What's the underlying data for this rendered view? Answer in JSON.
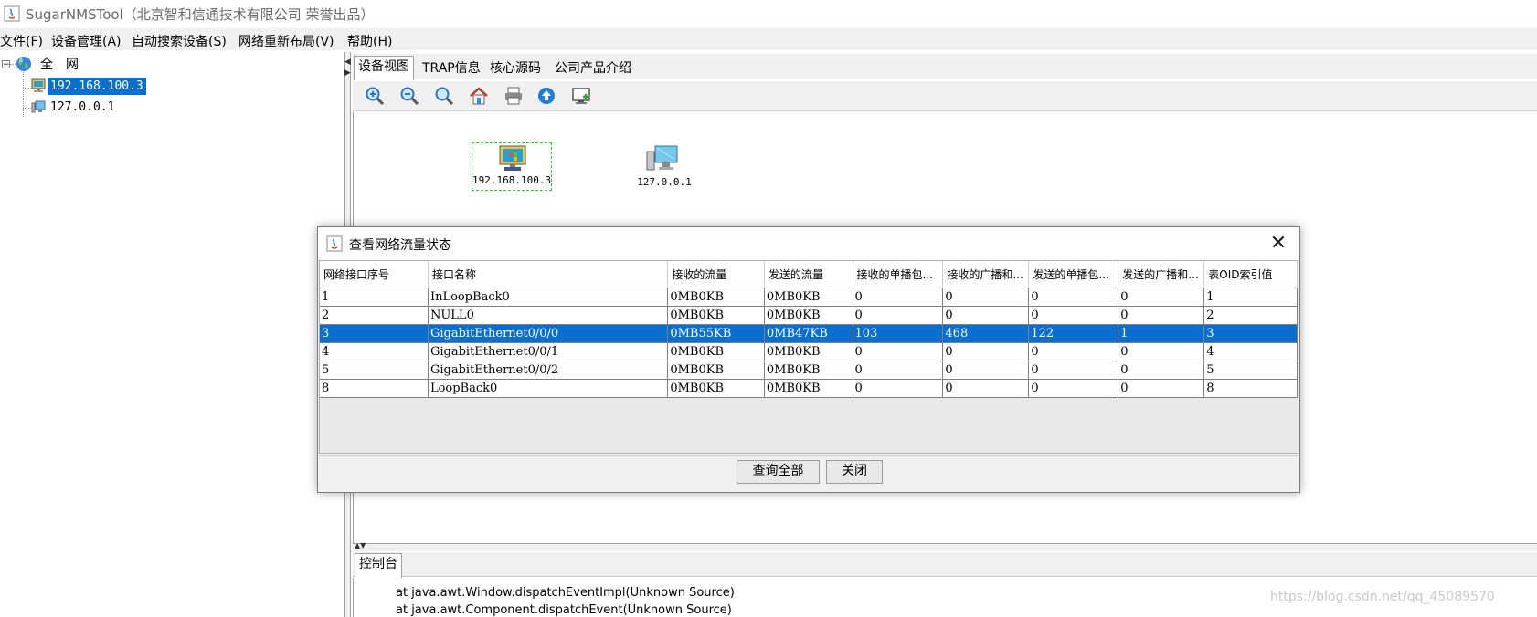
{
  "window": {
    "title": "SugarNMSTool（北京智和信通技术有限公司 荣誉出品）"
  },
  "menu": [
    {
      "label": "文件(F)"
    },
    {
      "label": "设备管理(A)"
    },
    {
      "label": "自动搜索设备(S)"
    },
    {
      "label": "网络重新布局(V)"
    },
    {
      "label": "帮助(H)"
    }
  ],
  "tree": {
    "root_label": "全　网",
    "nodes": [
      {
        "label": "192.168.100.3",
        "selected": true
      },
      {
        "label": "127.0.0.1",
        "selected": false
      }
    ]
  },
  "tabs": [
    {
      "label": "设备视图"
    },
    {
      "label": "TRAP信息"
    },
    {
      "label": "核心源码"
    },
    {
      "label": "公司产品介绍"
    }
  ],
  "toolbar": {
    "icons": [
      "zoom-in-icon",
      "zoom-out-icon",
      "zoom-fit-icon",
      "home-icon",
      "print-icon",
      "upload-icon",
      "monitor-add-icon"
    ]
  },
  "devices": [
    {
      "label": "192.168.100.3"
    },
    {
      "label": "127.0.0.1"
    }
  ],
  "dialog": {
    "title": "查看网络流量状态",
    "columns": [
      "网络接口序号",
      "接口名称",
      "接收的流量",
      "发送的流量",
      "接收的单播包...",
      "接收的广播和...",
      "发送的单播包...",
      "发送的广播和...",
      "表OID索引值"
    ],
    "rows": [
      [
        "1",
        "InLoopBack0",
        "0MB0KB",
        "0MB0KB",
        "0",
        "0",
        "0",
        "0",
        "1"
      ],
      [
        "2",
        "NULL0",
        "0MB0KB",
        "0MB0KB",
        "0",
        "0",
        "0",
        "0",
        "2"
      ],
      [
        "3",
        "GigabitEthernet0/0/0",
        "0MB55KB",
        "0MB47KB",
        "103",
        "468",
        "122",
        "1",
        "3"
      ],
      [
        "4",
        "GigabitEthernet0/0/1",
        "0MB0KB",
        "0MB0KB",
        "0",
        "0",
        "0",
        "0",
        "4"
      ],
      [
        "5",
        "GigabitEthernet0/0/2",
        "0MB0KB",
        "0MB0KB",
        "0",
        "0",
        "0",
        "0",
        "5"
      ],
      [
        "8",
        "LoopBack0",
        "0MB0KB",
        "0MB0KB",
        "0",
        "0",
        "0",
        "0",
        "8"
      ]
    ],
    "selected_row": 2,
    "buttons": {
      "query_all": "查询全部",
      "close": "关闭"
    },
    "close_glyph": "✕"
  },
  "console": {
    "tab_label": "控制台",
    "lines": [
      "at java.awt.Window.dispatchEventImpl(Unknown Source)",
      "at java.awt.Component.dispatchEvent(Unknown Source)"
    ]
  },
  "watermark": "https://blog.csdn.net/qq_45089570",
  "colors": {
    "selection": "#0a6fd1",
    "device_selection_border": "#2bcc2b"
  }
}
